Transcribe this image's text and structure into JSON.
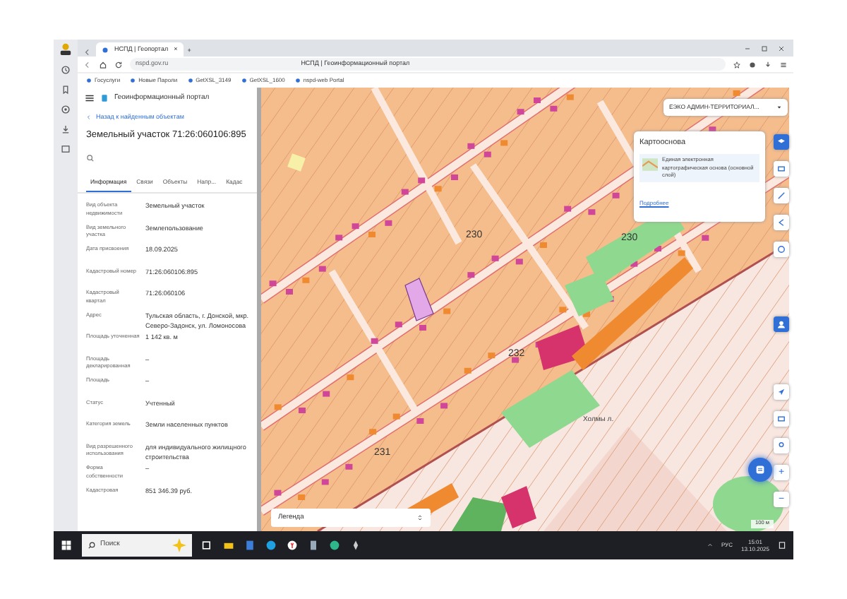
{
  "browser": {
    "tabs": [
      {
        "label": "НСПД | Геопортал",
        "close": "×",
        "selected": true
      }
    ],
    "new_tab": "+",
    "address": "nspd.gov.ru",
    "page_title": "НСПД | Геоинформационный портал",
    "bookmarks": [
      "Госуслуги",
      "Новые Пароли",
      "GetXSL_3149",
      "GetXSL_1600",
      "nspd-web Portal"
    ]
  },
  "panel": {
    "portal_title": "Геоинформационный портал",
    "back_link": "Назад к найденным объектам",
    "title": "Земельный участок 71:26:060106:895",
    "tabs": [
      {
        "label": "Информация",
        "selected": true
      },
      {
        "label": "Связи",
        "selected": false
      },
      {
        "label": "Объекты",
        "selected": false
      },
      {
        "label": "Напр...",
        "selected": false
      },
      {
        "label": "Кадас",
        "selected": false
      }
    ],
    "fields": [
      {
        "label": "Вид объекта недвижимости",
        "value": "Земельный участок"
      },
      {
        "label": "Вид земельного участка",
        "value": "Землепользование"
      },
      {
        "label": "Дата присвоения",
        "value": "18.09.2025"
      },
      {
        "label": "Кадастровый номер",
        "value": "71:26:060106:895"
      },
      {
        "label": "Кадастровый квартал",
        "value": "71:26:060106"
      },
      {
        "label": "Адрес",
        "value": "Тульская область, г. Донской, мкр. Северо-Задонск, ул. Ломоносова"
      },
      {
        "label": "Площадь уточненная",
        "value": "1 142 кв. м"
      },
      {
        "label": "Площадь декларированная",
        "value": "–"
      },
      {
        "label": "Площадь",
        "value": "–"
      },
      {
        "label": "Статус",
        "value": "Учтенный"
      },
      {
        "label": "Категория земель",
        "value": "Земли населенных пунктов"
      },
      {
        "label": "Вид разрешенного использования",
        "value": "для индивидуального жилищного строительства"
      },
      {
        "label": "Форма собственности",
        "value": "–"
      },
      {
        "label": "Кадастровая",
        "value": "851 346.39 руб."
      }
    ]
  },
  "map": {
    "layer_select": "ЕЭКО АДМИН-ТЕРРИТОРИАЛ...",
    "basemap": {
      "title": "Картооснова",
      "item": "Единая электронная картографическая основа (основной слой)",
      "link": "Подробнее"
    },
    "block_numbers": [
      "230",
      "230",
      "232",
      "231"
    ],
    "place_label": "Холмы л.",
    "legend": "Легенда",
    "zoom_in": "+",
    "zoom_out": "−",
    "scale": "100 м"
  },
  "taskbar": {
    "search_placeholder": "Поиск",
    "lang": "РУС",
    "time": "15:01",
    "date": "13.10.2025"
  }
}
